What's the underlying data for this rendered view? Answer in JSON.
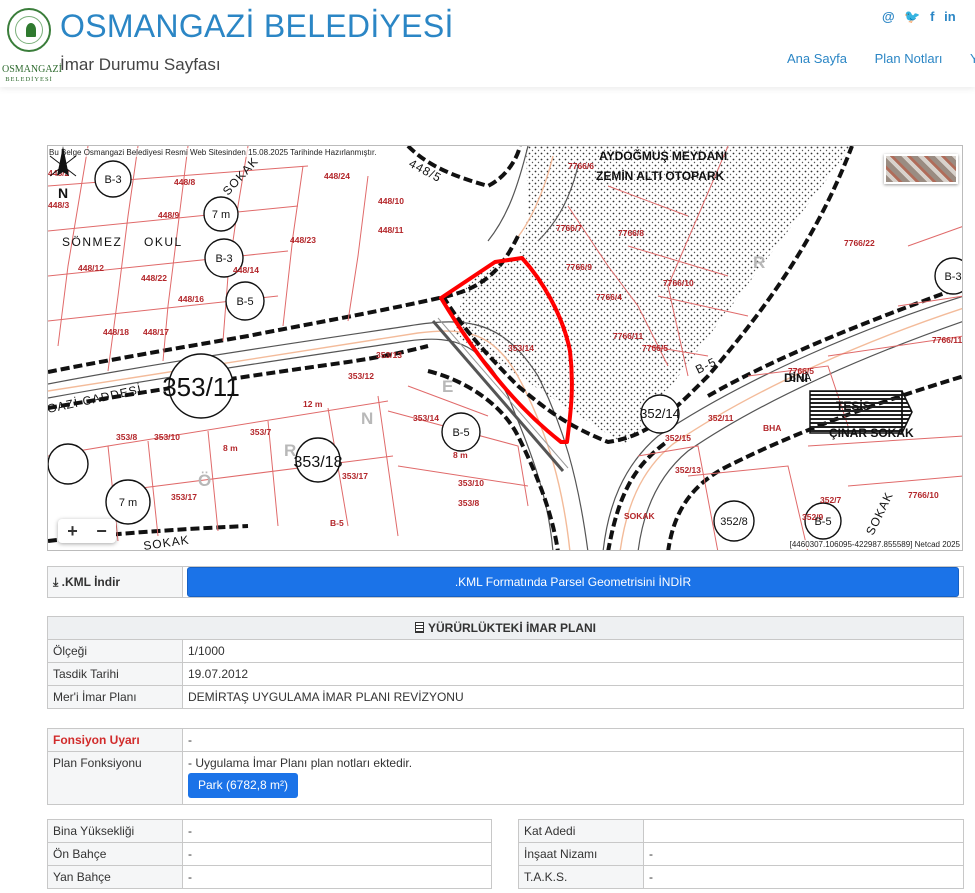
{
  "header": {
    "logo_name": "OSMANGAZİ",
    "logo_sub": "BELEDİYESİ",
    "title": "OSMANGAZİ BELEDİYESİ",
    "subtitle": "İmar Durumu Sayfası",
    "social": [
      "@",
      "🐦",
      "f",
      "in"
    ],
    "nav": [
      "Ana Sayfa",
      "Plan Notları",
      "Ya"
    ]
  },
  "map": {
    "note": "Bu Belge Osmangazi Belediyesi Resmi Web Sitesinden 15.08.2025 Tarihinde Hazırlanmıştır.",
    "coords": "[4460307.106095-422987.855589] Netcad 2025",
    "zoom_in": "+",
    "zoom_out": "−",
    "north": "N",
    "labels": [
      "448/2",
      "B-3",
      "448/8",
      "SOKAK",
      "448/24",
      "448/3",
      "448/10",
      "7 m",
      "448/23",
      "448/11",
      "448/9",
      "SÖNMEZ",
      "OKUL",
      "B-3",
      "448/14",
      "448/22",
      "448/12",
      "448/16",
      "B-5",
      "448/18",
      "448/17",
      "7766/6",
      "7766/7",
      "7766/8",
      "7766/22",
      "7766/9",
      "7766/4",
      "7766/10",
      "7766/11",
      "7766/5",
      "353/14",
      "353/13",
      "353/12",
      "12 m",
      "353/11",
      "353/7",
      "353/8",
      "353/10",
      "8 m",
      "353/18",
      "353/17",
      "B-5",
      "B-5",
      "7 m",
      "352/14",
      "352/15",
      "352/13",
      "352/11",
      "BHA",
      "DİNİ",
      "TESİS",
      "ÇINAR SOKAK",
      "B-5",
      "352/8",
      "352/7",
      "352/9",
      "SOKAK",
      "448/5",
      "GAZİ CADDESİ",
      "SOKAK",
      "R",
      "R",
      "Ö",
      "N",
      "E",
      "AYDOĞMUŞ MEYDANI",
      "ZEMİN ALTI OTOPARK",
      "B-3",
      "B-5"
    ]
  },
  "kml": {
    "label": ".KML İndir",
    "button": ".KML Formatında Parsel Geometrisini İNDİR"
  },
  "plan": {
    "heading": "YÜRÜRLÜKTEKİ İMAR PLANI",
    "rows": [
      {
        "label": "Ölçeği",
        "value": "1/1000"
      },
      {
        "label": "Tasdik Tarihi",
        "value": "19.07.2012"
      },
      {
        "label": "Mer'i İmar Planı",
        "value": "DEMİRTAŞ UYGULAMA İMAR PLANI REVİZYONU"
      }
    ]
  },
  "function": {
    "warning_label": "Fonsiyon Uyarı",
    "warning_value": "-",
    "function_label": "Plan Fonksiyonu",
    "function_value": "- Uygulama İmar Planı plan notları ektedir.",
    "park_button": "Park (6782,8 m²)"
  },
  "left_table": [
    {
      "label": "Bina Yüksekliği",
      "value": "-"
    },
    {
      "label": "Ön Bahçe",
      "value": "-"
    },
    {
      "label": "Yan Bahçe",
      "value": "-"
    }
  ],
  "right_table": [
    {
      "label": "Kat Adedi",
      "value": ""
    },
    {
      "label": "İnşaat Nizamı",
      "value": "-"
    },
    {
      "label": "T.A.K.S.",
      "value": "-"
    }
  ],
  "colors": {
    "accent": "#2b86c5",
    "button": "#1b73e8",
    "warning": "#d12b2b",
    "parcel_highlight": "#ff0000",
    "parcel_lines": "#e06a6a"
  }
}
